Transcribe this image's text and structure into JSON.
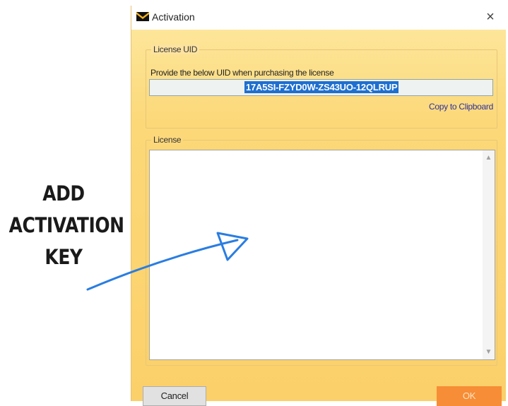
{
  "annotation": {
    "lines": [
      "ADD",
      "ACTIVATION",
      "KEY"
    ],
    "arrow_color": "#2a7de1"
  },
  "window": {
    "title": "Activation",
    "close_symbol": "×",
    "icon": "mail-envelope-icon",
    "background": "#fcd66c"
  },
  "uid_group": {
    "legend": "License UID",
    "description": "Provide the below UID when purchasing the license",
    "uid_value": "17A5SI-FZYD0W-ZS43UO-12QLRUP",
    "copy_link": "Copy to Clipboard"
  },
  "license_group": {
    "legend": "License",
    "value": ""
  },
  "buttons": {
    "cancel": "Cancel",
    "ok": "OK"
  }
}
